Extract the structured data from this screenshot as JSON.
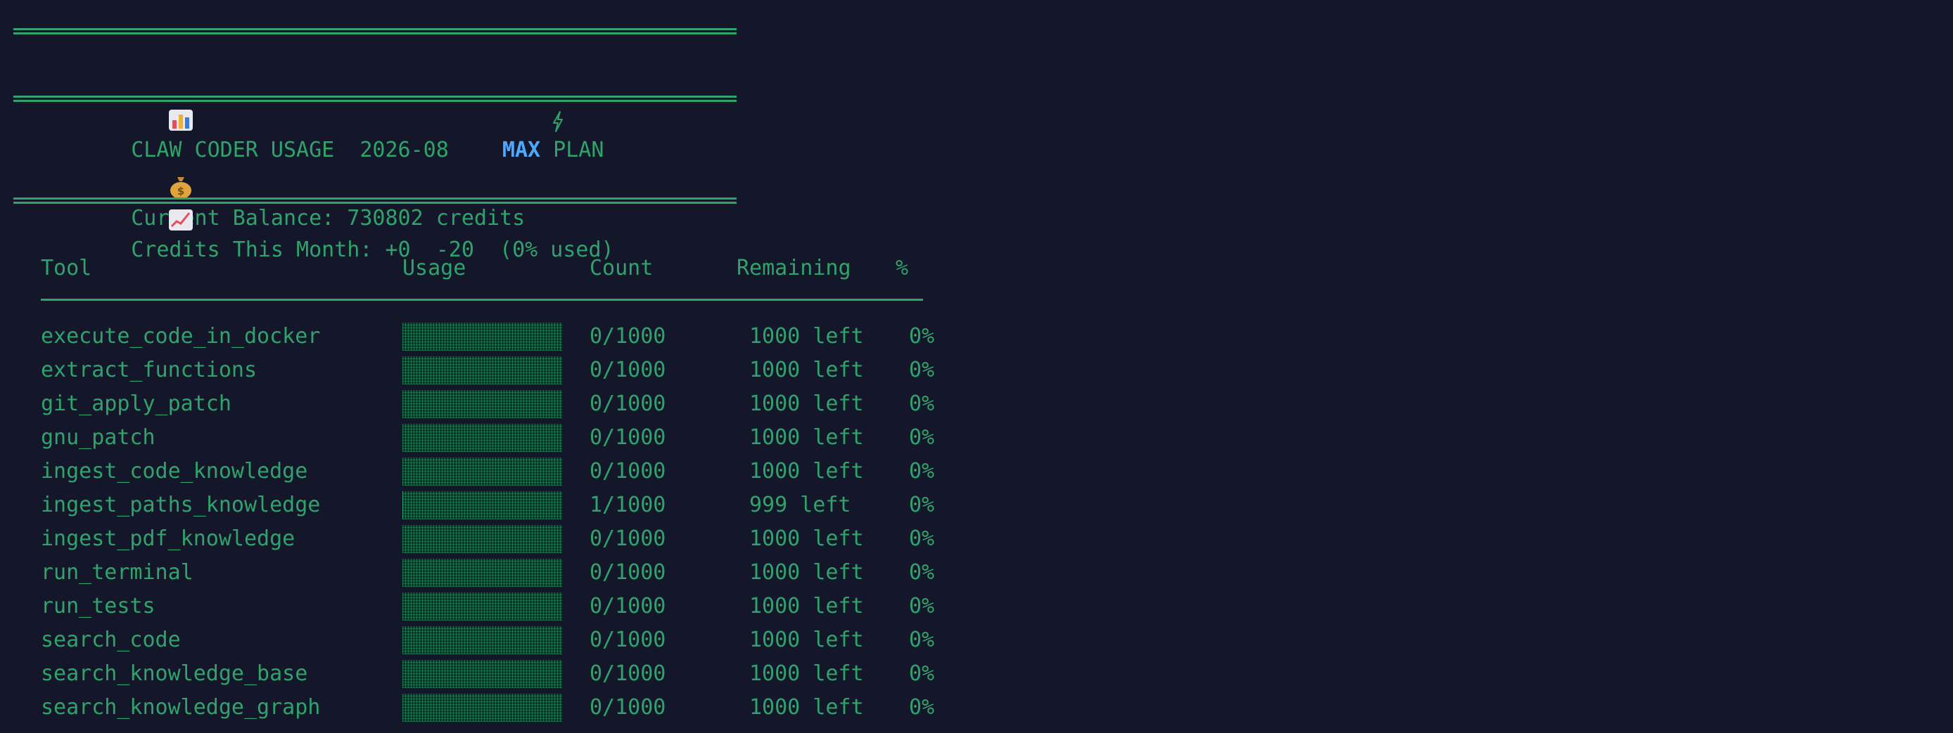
{
  "header": {
    "title": "CLAW CODER USAGE",
    "month": "2026-08",
    "plan_highlight": "MAX",
    "plan_suffix": "PLAN"
  },
  "summary": {
    "balance_label": "Current Balance:",
    "balance_value": "730802 credits",
    "month_label": "Credits This Month:",
    "month_value": "+0  -20  (0% used)"
  },
  "table": {
    "columns": [
      "Tool",
      "Usage",
      "Count",
      "Remaining",
      "%"
    ],
    "rows": [
      {
        "tool": "execute_code_in_docker",
        "count": "0/1000",
        "remaining": "1000 left",
        "pct": "0%",
        "usage_fraction": 0
      },
      {
        "tool": "extract_functions",
        "count": "0/1000",
        "remaining": "1000 left",
        "pct": "0%",
        "usage_fraction": 0
      },
      {
        "tool": "git_apply_patch",
        "count": "0/1000",
        "remaining": "1000 left",
        "pct": "0%",
        "usage_fraction": 0
      },
      {
        "tool": "gnu_patch",
        "count": "0/1000",
        "remaining": "1000 left",
        "pct": "0%",
        "usage_fraction": 0
      },
      {
        "tool": "ingest_code_knowledge",
        "count": "0/1000",
        "remaining": "1000 left",
        "pct": "0%",
        "usage_fraction": 0
      },
      {
        "tool": "ingest_paths_knowledge",
        "count": "1/1000",
        "remaining": "999 left",
        "pct": "0%",
        "usage_fraction": 0.001
      },
      {
        "tool": "ingest_pdf_knowledge",
        "count": "0/1000",
        "remaining": "1000 left",
        "pct": "0%",
        "usage_fraction": 0
      },
      {
        "tool": "run_terminal",
        "count": "0/1000",
        "remaining": "1000 left",
        "pct": "0%",
        "usage_fraction": 0
      },
      {
        "tool": "run_tests",
        "count": "0/1000",
        "remaining": "1000 left",
        "pct": "0%",
        "usage_fraction": 0
      },
      {
        "tool": "search_code",
        "count": "0/1000",
        "remaining": "1000 left",
        "pct": "0%",
        "usage_fraction": 0
      },
      {
        "tool": "search_knowledge_base",
        "count": "0/1000",
        "remaining": "1000 left",
        "pct": "0%",
        "usage_fraction": 0
      },
      {
        "tool": "search_knowledge_graph",
        "count": "0/1000",
        "remaining": "1000 left",
        "pct": "0%",
        "usage_fraction": 0
      }
    ]
  },
  "icons": {
    "title": "bar-chart-icon",
    "plan": "lightning-icon",
    "balance": "money-bag-icon",
    "month": "trending-up-icon"
  },
  "colors": {
    "background": "#131729",
    "text": "#2fa36b",
    "accent": "#4da8ff"
  }
}
